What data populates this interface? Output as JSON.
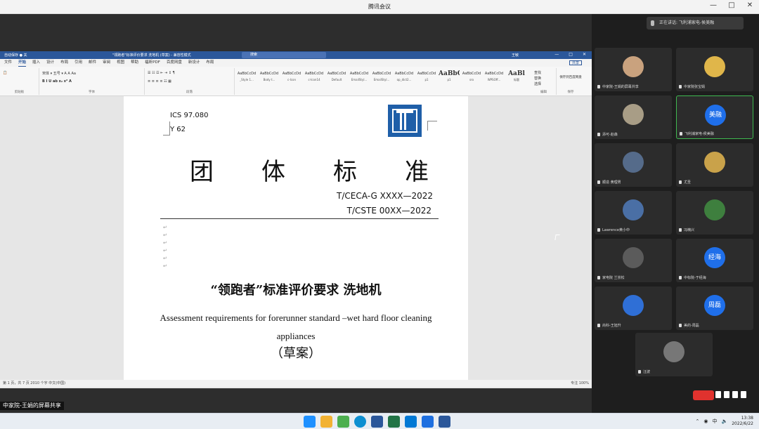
{
  "app": {
    "title": "腾讯会议",
    "controls": [
      "—",
      "□",
      "✕"
    ]
  },
  "word": {
    "autosave": "自动保存 ● 关",
    "doc_title": "\"领跑者\"标准评价要求 洗地机 (草案) - 兼容性模式",
    "search": "搜索",
    "user": "王敏",
    "menu": [
      "文件",
      "开始",
      "插入",
      "设计",
      "布局",
      "引用",
      "邮件",
      "审阅",
      "视图",
      "帮助",
      "福昕PDF",
      "百度网盘",
      "新设计",
      "布局"
    ],
    "active_menu": "开始",
    "share_button": "共享",
    "ribbon_groups": [
      "剪贴板",
      "字体",
      "段落",
      "样式",
      "编辑",
      "保存"
    ],
    "font_name": "宋体",
    "font_size": "五号",
    "styles": [
      {
        "sample": "AaBbCcDd",
        "name": "_Style 1..."
      },
      {
        "sample": "AaBbCcDd",
        "name": "Body t..."
      },
      {
        "sample": "AaBbCcDd",
        "name": "c-Icon"
      },
      {
        "sample": "AaBbCcDd",
        "name": "c-Icon14"
      },
      {
        "sample": "AaBbCcDd",
        "name": "Default"
      },
      {
        "sample": "AaBbCcDd",
        "name": "EmailStyl..."
      },
      {
        "sample": "AaBbCcDd",
        "name": "EmailStyl..."
      },
      {
        "sample": "AaBbCcDd",
        "name": "op_dict2..."
      },
      {
        "sample": "AaBbCcDd",
        "name": "p1"
      },
      {
        "sample": "AaBbCc",
        "name": "p1"
      },
      {
        "sample": "AaBbCcDd",
        "name": "sro"
      },
      {
        "sample": "AaBbCcDd",
        "name": "WPSOff..."
      },
      {
        "sample": "AaBl",
        "name": "标题"
      }
    ],
    "edit_items": [
      "查找",
      "替换",
      "选择"
    ],
    "save_label": "保存到百度网盘",
    "status_left": "第 1 页，共 7 页   2010 个字   中文(中国)",
    "status_right": "专注        100%"
  },
  "document": {
    "ics": "ICS 97.080",
    "ycode": "Y 62",
    "main_title": [
      "团",
      "体",
      "标",
      "准"
    ],
    "tcode1": "T/CECA-G XXXX—2022",
    "tcode2": "T/CSTE 00XX—2022",
    "cn_title": "“领跑者”标准评价要求  洗地机",
    "en_title": "Assessment requirements for forerunner standard –wet hard floor cleaning appliances",
    "draft": "（草案）"
  },
  "share_label": "中家院-王娟的屏幕共享",
  "panel": {
    "speaking": "正在讲话: 飞利浦家电-侯美融",
    "participants": [
      {
        "name": "中家院-王娟的屏幕共享",
        "avatar": "photo"
      },
      {
        "name": "中家院张宝娟",
        "avatar": "photo"
      },
      {
        "name": "添可-赵森",
        "avatar": "photo"
      },
      {
        "name": "飞利浦家电-侯美融",
        "avatar": "美融",
        "active": true
      },
      {
        "name": "顺造 黄理男",
        "avatar": "photo"
      },
      {
        "name": "尤圣",
        "avatar": "photo"
      },
      {
        "name": "Lawrence黄小中",
        "avatar": "photo"
      },
      {
        "name": "冯楠兴",
        "avatar": "photo"
      },
      {
        "name": "家电院 兰崇松",
        "avatar": "photo"
      },
      {
        "name": "中标院-于经海",
        "avatar": "经海"
      },
      {
        "name": "尚科-王旭升",
        "avatar": "photo"
      },
      {
        "name": "美的-周磊",
        "avatar": "周磊"
      },
      {
        "name": "汪波",
        "avatar": "photo"
      }
    ]
  },
  "taskbar": {
    "time": "13:38",
    "date": "2022/6/22",
    "ime": "中"
  }
}
